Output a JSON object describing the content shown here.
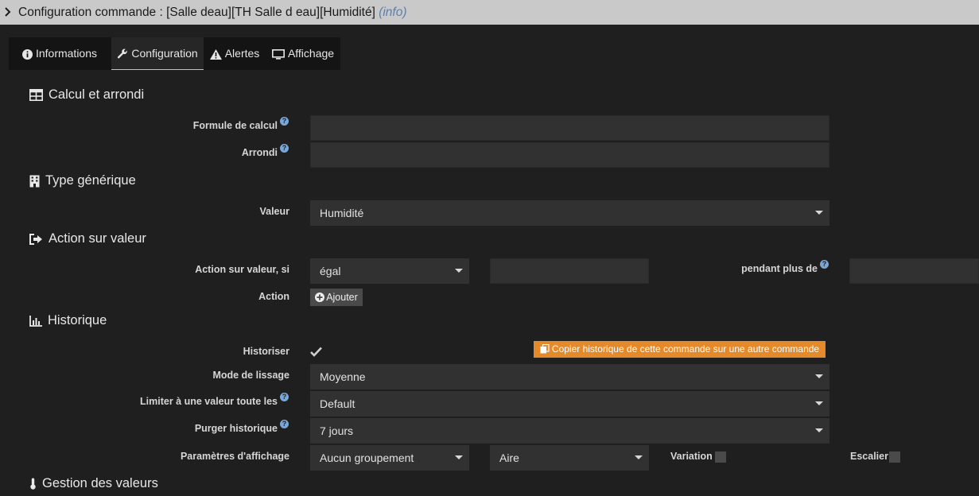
{
  "title": {
    "prefix": "Configuration commande : [Salle deau][TH Salle d eau][Humidité]",
    "info": "(info)"
  },
  "tabs": [
    {
      "label": "Informations",
      "icon": "info-circle-icon"
    },
    {
      "label": "Configuration",
      "icon": "wrench-icon"
    },
    {
      "label": "Alertes",
      "icon": "warning-icon"
    },
    {
      "label": "Affichage",
      "icon": "monitor-icon"
    }
  ],
  "calcul": {
    "heading": "Calcul et arrondi",
    "formule_label": "Formule de calcul",
    "formule_value": "",
    "arrondi_label": "Arrondi",
    "arrondi_value": ""
  },
  "type_generique": {
    "heading": "Type générique",
    "valeur_label": "Valeur",
    "valeur_selected": "Humidité"
  },
  "action_valeur": {
    "heading": "Action sur valeur",
    "si_label": "Action sur valeur, si",
    "operator_selected": "égal",
    "compare_value": "",
    "pendant_label": "pendant plus de",
    "pendant_value": "",
    "action_label": "Action",
    "add_button": "Ajouter"
  },
  "historique": {
    "heading": "Historique",
    "historiser_label": "Historiser",
    "historiser_checked": true,
    "copy_button": "Copier historique de cette commande sur une autre commande",
    "lissage_label": "Mode de lissage",
    "lissage_selected": "Moyenne",
    "limiter_label": "Limiter à une valeur toute les",
    "limiter_selected": "Default",
    "purger_label": "Purger historique",
    "purger_selected": "7 jours",
    "affichage_label": "Paramètres d'affichage",
    "groupement_selected": "Aucun groupement",
    "type_selected": "Aire",
    "variation_label": "Variation",
    "escalier_label": "Escalier"
  },
  "gestion": {
    "heading": "Gestion des valeurs"
  },
  "colors": {
    "accent_tab_underline": "#b6d96a",
    "copy_button": "#e48a2b",
    "help_icon": "#7aa7d8"
  }
}
